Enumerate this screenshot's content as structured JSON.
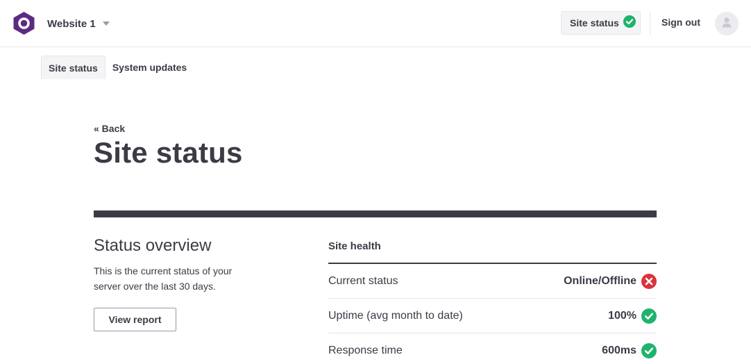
{
  "header": {
    "site_name": "Website 1",
    "status_label": "Site status",
    "sign_out": "Sign out"
  },
  "tabs": [
    {
      "label": "Site status",
      "active": true
    },
    {
      "label": "System updates",
      "active": false
    }
  ],
  "main": {
    "back": "« Back",
    "title": "Site status",
    "overview_title": "Status overview",
    "overview_desc": "This is the current status of your server over the last 30 days.",
    "view_report": "View report",
    "health_title": "Site health",
    "rows": [
      {
        "key": "Current status",
        "value": "Online/Offline",
        "state": "error"
      },
      {
        "key": "Uptime (avg month to date)",
        "value": "100%",
        "state": "ok"
      },
      {
        "key": "Response time",
        "value": "600ms",
        "state": "ok"
      }
    ]
  },
  "colors": {
    "brand": "#5b2b82",
    "ok": "#1fb36b",
    "error": "#d9343c",
    "text": "#3b3b46"
  },
  "icons": {
    "logo": "brand-logo-icon",
    "caret": "chevron-down-icon",
    "ok": "check-circle-icon",
    "error": "x-circle-icon",
    "avatar": "user-icon"
  }
}
